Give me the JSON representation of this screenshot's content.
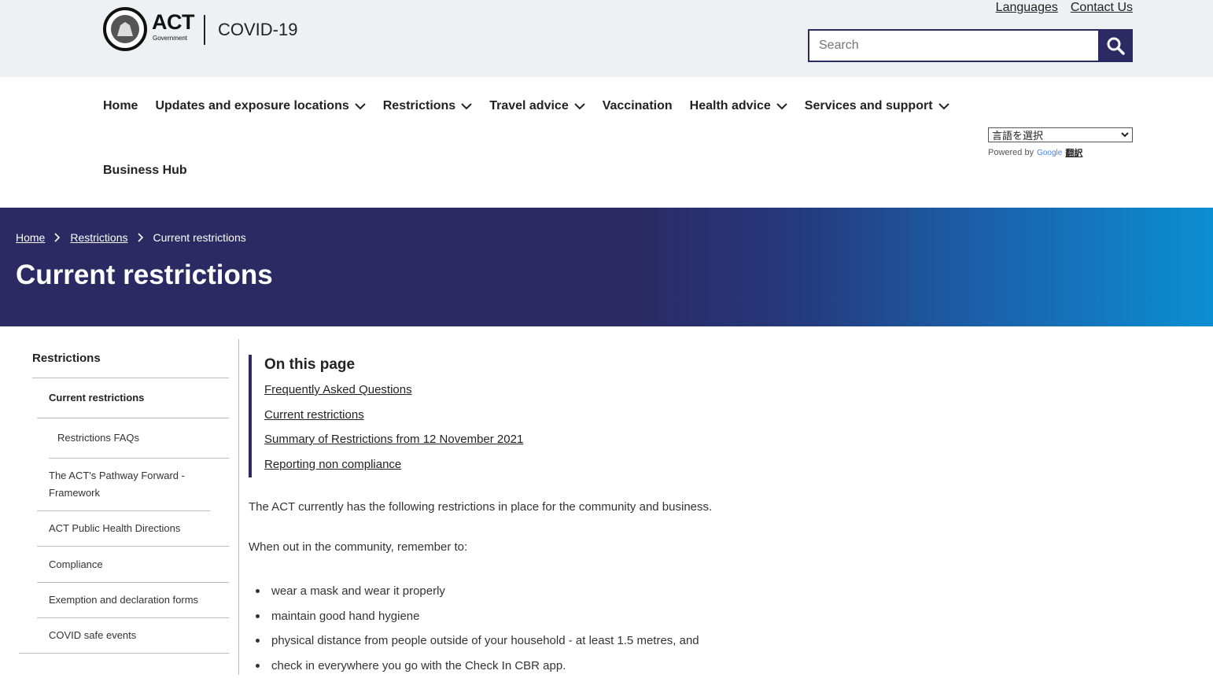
{
  "header": {
    "brand_act": "ACT",
    "brand_government": "Government",
    "site_name": "COVID-19",
    "top_links": [
      "Languages",
      "Contact Us"
    ],
    "search_placeholder": "Search"
  },
  "nav": {
    "items": [
      {
        "label": "Home",
        "has_dropdown": false
      },
      {
        "label": "Updates and exposure locations",
        "has_dropdown": true
      },
      {
        "label": "Restrictions",
        "has_dropdown": true
      },
      {
        "label": "Travel advice",
        "has_dropdown": true
      },
      {
        "label": "Vaccination",
        "has_dropdown": false
      },
      {
        "label": "Health advice",
        "has_dropdown": true
      },
      {
        "label": "Services and support",
        "has_dropdown": true
      }
    ],
    "second_row": "Business Hub"
  },
  "translate": {
    "selected": "言語を選択",
    "powered_by": "Powered by",
    "google": "Google",
    "translate_label": "翻訳"
  },
  "banner": {
    "breadcrumbs": [
      "Home",
      "Restrictions",
      "Current restrictions"
    ],
    "title": "Current restrictions",
    "colors": {
      "dark": "#2b2a63",
      "light": "#0b8fd2"
    }
  },
  "sidebar": {
    "heading": "Restrictions",
    "items": [
      {
        "label": "Current restrictions"
      },
      {
        "label": "Restrictions FAQs"
      },
      {
        "label": "The ACT's Pathway Forward - Framework"
      },
      {
        "label": "ACT Public Health Directions"
      },
      {
        "label": "Compliance"
      },
      {
        "label": "Exemption and declaration forms"
      },
      {
        "label": "COVID safe events"
      }
    ]
  },
  "content": {
    "on_this_page_title": "On this page",
    "on_this_page_links": [
      "Frequently Asked Questions",
      "Current restrictions",
      "Summary of Restrictions from 12 November 2021",
      "Reporting non compliance"
    ],
    "intro": "The ACT currently has the following restrictions in place for the community and business.",
    "remember": "When out in the community, remember to:",
    "bullets": [
      "wear a mask and wear it properly",
      "maintain good hand hygiene",
      "physical distance from people outside of your household - at least 1.5 metres, and",
      "check in everywhere you go with the Check In CBR app."
    ]
  }
}
